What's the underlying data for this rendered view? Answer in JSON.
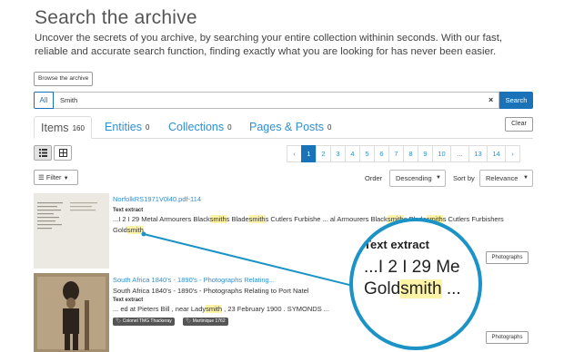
{
  "page": {
    "title": "Search the archive",
    "subtitle": "Uncover the secrets of you archive, by searching your entire collection withinin seconds. With our fast, reliable and accurate search function, finding exactly what you are looking for has never been easier."
  },
  "browse_label": "Browse the archive",
  "search": {
    "scope": "All",
    "query": "Smith",
    "clear_glyph": "×",
    "button_label": "Search"
  },
  "tabs": [
    {
      "label": "Items",
      "count": "160"
    },
    {
      "label": "Entities",
      "count": "0"
    },
    {
      "label": "Collections",
      "count": "0"
    },
    {
      "label": "Pages & Posts",
      "count": "0"
    }
  ],
  "clear_label": "Clear",
  "pagination": {
    "prev": "‹",
    "pages": [
      "1",
      "2",
      "3",
      "4",
      "5",
      "6",
      "7",
      "8",
      "9",
      "10",
      "...",
      "13",
      "14"
    ],
    "next": "›"
  },
  "filter_label": "Filter",
  "order": {
    "label": "Order",
    "value": "Descending"
  },
  "sort": {
    "label": "Sort by",
    "value": "Relevance"
  },
  "results": [
    {
      "title": "NorfolkRS1971V0l40.pdf-114",
      "label": "Text extract",
      "extract_1a": "...I 2 I 29 Metal Armourers Black",
      "extract_1b": "smith",
      "extract_1c": "s Blade",
      "extract_1d": "smith",
      "extract_1e": "s Cutlers Furbishe ... al Armourers Black",
      "extract_1f": "smith",
      "extract_1g": "s Blade",
      "extract_1h": "smith",
      "extract_1i": "s Cutlers Furbishers",
      "extract_2a": "Gold",
      "extract_2b": "smith",
      "type": "Photographs"
    },
    {
      "title": "South Africa 1840's - 1890's - Photographs Relating...",
      "subtitle": "South Africa 1840's - 1890's - Photographs Relating to Port Natel",
      "label": "Text extract",
      "extract_a": "... ed at Pieters Bill , near Lady",
      "extract_b": "smith",
      "extract_c": " , 23 February 1900 . SYMONDS ...",
      "tags": [
        "Colonel TMG Thackeray",
        "Martinique 1762"
      ],
      "type": "Photographs"
    }
  ],
  "magnifier": {
    "label": "Text extract",
    "line1": "...I 2 I 29 Me",
    "line2a": "Gold",
    "line2b": "smith",
    "line2c": " ...",
    "accent": "#1b93c6"
  },
  "colors": {
    "primary": "#1a73b8",
    "link": "#2f8fd4",
    "highlight": "#fdf3a6"
  }
}
